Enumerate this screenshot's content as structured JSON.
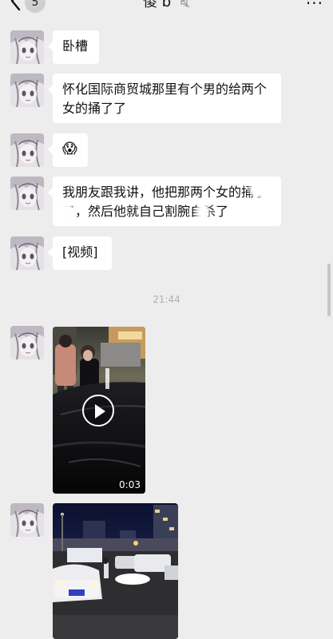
{
  "header": {
    "back_count": "5",
    "title": "傻 b",
    "more": "···"
  },
  "messages": [
    {
      "type": "text",
      "text": "卧槽"
    },
    {
      "type": "text",
      "text": "怀化国际商贸城那里有个男的给两个女的捅了了"
    },
    {
      "type": "emoji",
      "text": "😱"
    },
    {
      "type": "text",
      "text": "我朋友跟我讲，他把那两个女的捅了了，然后他就自己割腕自杀了"
    },
    {
      "type": "text",
      "text": "[视频]"
    },
    {
      "type": "video",
      "duration": "0:03"
    },
    {
      "type": "image"
    }
  ],
  "timestamp": "21:44",
  "colors": {
    "background": "#ededed",
    "bubble": "#ffffff",
    "timestamp": "#b0b0b0"
  }
}
